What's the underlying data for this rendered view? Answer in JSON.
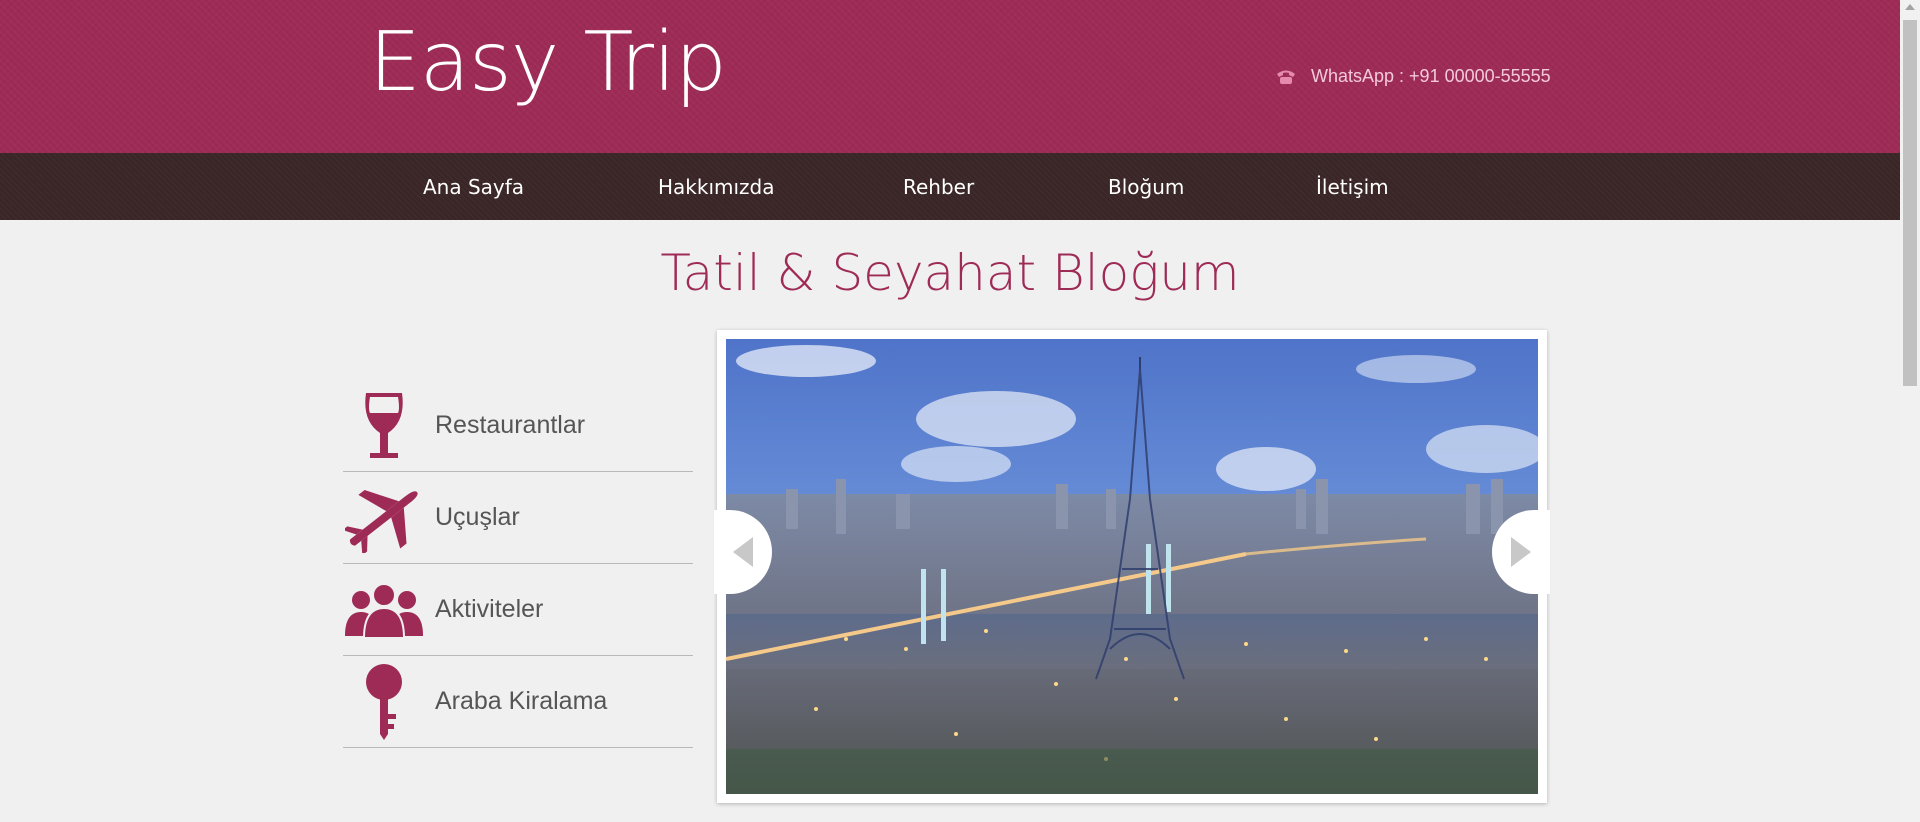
{
  "header": {
    "logo": "Easy Trip",
    "contact": "WhatsApp : +91 00000-55555",
    "contact_icon": "phone-icon"
  },
  "nav": {
    "items": [
      {
        "label": "Ana Sayfa"
      },
      {
        "label": "Hakkımızda"
      },
      {
        "label": "Rehber"
      },
      {
        "label": "Bloğum"
      },
      {
        "label": "İletişim"
      }
    ]
  },
  "main": {
    "title": "Tatil & Seyahat Bloğum"
  },
  "sidebar": {
    "items": [
      {
        "label": "Restaurantlar",
        "icon": "wine-glass-icon"
      },
      {
        "label": "Uçuşlar",
        "icon": "airplane-icon"
      },
      {
        "label": "Aktiviteler",
        "icon": "people-icon"
      },
      {
        "label": "Araba Kiralama",
        "icon": "key-icon"
      }
    ]
  },
  "slider": {
    "prev_icon": "chevron-left-icon",
    "next_icon": "chevron-right-icon"
  },
  "colors": {
    "brand": "#9e2b56",
    "nav_bg": "#3a2626",
    "page_bg": "#f0f0f0",
    "text": "#555555"
  }
}
